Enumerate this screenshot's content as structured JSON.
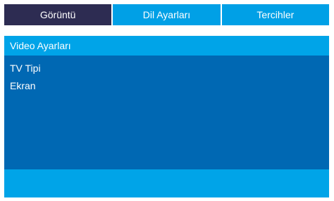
{
  "tabs": [
    {
      "label": "Görüntü",
      "active": true
    },
    {
      "label": "Dil Ayarları",
      "active": false
    },
    {
      "label": "Tercihler",
      "active": false
    }
  ],
  "section": {
    "title": "Video Ayarları"
  },
  "menu": {
    "items": [
      {
        "label": "TV Tipi"
      },
      {
        "label": "Ekran"
      }
    ]
  },
  "colors": {
    "active_tab": "#2d2c52",
    "inactive_tab": "#00a0e6",
    "header": "#00a4e8",
    "panel": "#0068b3",
    "text": "#ffffff"
  }
}
